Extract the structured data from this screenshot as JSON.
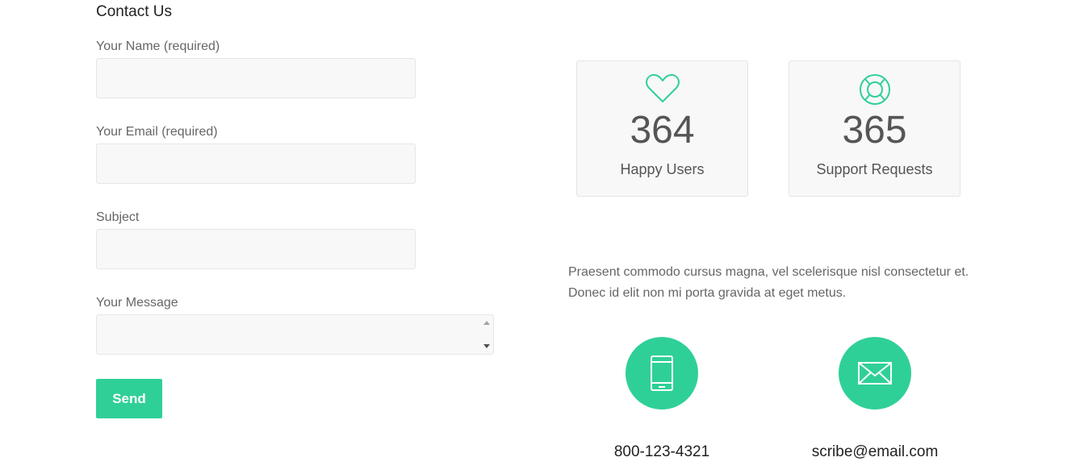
{
  "form": {
    "title": "Contact Us",
    "name_label": "Your Name (required)",
    "name_value": "",
    "email_label": "Your Email (required)",
    "email_value": "",
    "subject_label": "Subject",
    "subject_value": "",
    "message_label": "Your Message",
    "message_value": "",
    "send_label": "Send"
  },
  "stats": [
    {
      "number": "364",
      "label": "Happy Users",
      "icon": "heart-icon"
    },
    {
      "number": "365",
      "label": "Support Requests",
      "icon": "lifebuoy-icon"
    }
  ],
  "description_lines": [
    "Praesent commodo cursus magna, vel scelerisque nisl consectetur et.",
    "Donec id elit non mi porta gravida at eget metus."
  ],
  "contacts": [
    {
      "icon": "phone-icon",
      "text": "800-123-4321"
    },
    {
      "icon": "envelope-icon",
      "text": "scribe@email.com"
    }
  ],
  "colors": {
    "accent": "#2fd097",
    "field_bg": "#f8f8f8",
    "text": "#666666",
    "heading": "#222222"
  }
}
